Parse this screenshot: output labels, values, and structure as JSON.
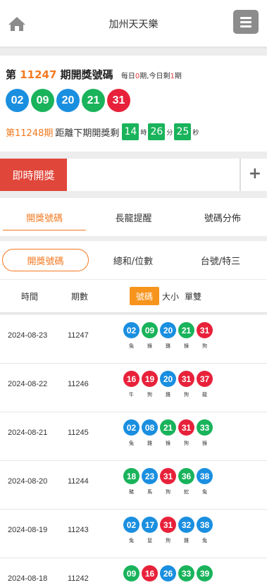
{
  "header": {
    "title": "加州天天樂",
    "home_icon": "home-icon",
    "menu_icon": "hamburger-menu-icon"
  },
  "current": {
    "prefix": "第",
    "issue": "11247",
    "suffix": "期開獎號碼",
    "info_daily": "每日",
    "info_daily_count": "0",
    "info_daily_unit": "期,今日剩",
    "info_left": "1",
    "info_left_unit": "期",
    "balls": [
      {
        "num": "02",
        "color": "#1a8fe0"
      },
      {
        "num": "09",
        "color": "#19b35b"
      },
      {
        "num": "20",
        "color": "#1a8fe0"
      },
      {
        "num": "21",
        "color": "#19b35b"
      },
      {
        "num": "31",
        "color": "#e8213a"
      }
    ]
  },
  "countdown": {
    "next_issue": "第11248期",
    "label": "距離下期開獎剩",
    "hours": "14",
    "hours_unit": "時",
    "minutes": "26",
    "minutes_unit": "分",
    "seconds": "25",
    "seconds_unit": "秒"
  },
  "live": {
    "label": "即時開獎",
    "plus": "+"
  },
  "tabs": [
    "開獎號碼",
    "長龍提醒",
    "號碼分佈"
  ],
  "subtabs": [
    "開獎號碼",
    "總和/位數",
    "台號/特三"
  ],
  "table": {
    "col_time": "時間",
    "col_issue": "期數",
    "toggle": [
      "號碼",
      "大小",
      "單雙"
    ]
  },
  "rows": [
    {
      "date": "2024-08-23",
      "issue": "11247",
      "balls": [
        {
          "num": "02",
          "color": "#1a8fe0",
          "zodiac": "兔"
        },
        {
          "num": "09",
          "color": "#19b35b",
          "zodiac": "猴"
        },
        {
          "num": "20",
          "color": "#1a8fe0",
          "zodiac": "雞"
        },
        {
          "num": "21",
          "color": "#19b35b",
          "zodiac": "猴"
        },
        {
          "num": "31",
          "color": "#e8213a",
          "zodiac": "狗"
        }
      ]
    },
    {
      "date": "2024-08-22",
      "issue": "11246",
      "balls": [
        {
          "num": "16",
          "color": "#e8213a",
          "zodiac": "牛"
        },
        {
          "num": "19",
          "color": "#e8213a",
          "zodiac": "狗"
        },
        {
          "num": "20",
          "color": "#1a8fe0",
          "zodiac": "雞"
        },
        {
          "num": "31",
          "color": "#e8213a",
          "zodiac": "狗"
        },
        {
          "num": "37",
          "color": "#e8213a",
          "zodiac": "龍"
        }
      ]
    },
    {
      "date": "2024-08-21",
      "issue": "11245",
      "balls": [
        {
          "num": "02",
          "color": "#1a8fe0",
          "zodiac": "兔"
        },
        {
          "num": "08",
          "color": "#1a8fe0",
          "zodiac": "雞"
        },
        {
          "num": "21",
          "color": "#19b35b",
          "zodiac": "猴"
        },
        {
          "num": "31",
          "color": "#e8213a",
          "zodiac": "狗"
        },
        {
          "num": "33",
          "color": "#19b35b",
          "zodiac": "猴"
        }
      ]
    },
    {
      "date": "2024-08-20",
      "issue": "11244",
      "balls": [
        {
          "num": "18",
          "color": "#19b35b",
          "zodiac": "豬"
        },
        {
          "num": "23",
          "color": "#1a8fe0",
          "zodiac": "馬"
        },
        {
          "num": "31",
          "color": "#e8213a",
          "zodiac": "狗"
        },
        {
          "num": "36",
          "color": "#19b35b",
          "zodiac": "蛇"
        },
        {
          "num": "38",
          "color": "#1a8fe0",
          "zodiac": "兔"
        }
      ]
    },
    {
      "date": "2024-08-19",
      "issue": "11243",
      "balls": [
        {
          "num": "02",
          "color": "#1a8fe0",
          "zodiac": "兔"
        },
        {
          "num": "17",
          "color": "#1a8fe0",
          "zodiac": "鼠"
        },
        {
          "num": "31",
          "color": "#e8213a",
          "zodiac": "狗"
        },
        {
          "num": "32",
          "color": "#1a8fe0",
          "zodiac": "雞"
        },
        {
          "num": "38",
          "color": "#1a8fe0",
          "zodiac": "兔"
        }
      ]
    },
    {
      "date": "2024-08-18",
      "issue": "11242",
      "balls": [
        {
          "num": "09",
          "color": "#19b35b",
          "zodiac": ""
        },
        {
          "num": "16",
          "color": "#e8213a",
          "zodiac": ""
        },
        {
          "num": "26",
          "color": "#1a8fe0",
          "zodiac": ""
        },
        {
          "num": "33",
          "color": "#19b35b",
          "zodiac": ""
        },
        {
          "num": "39",
          "color": "#19b35b",
          "zodiac": ""
        }
      ]
    }
  ]
}
